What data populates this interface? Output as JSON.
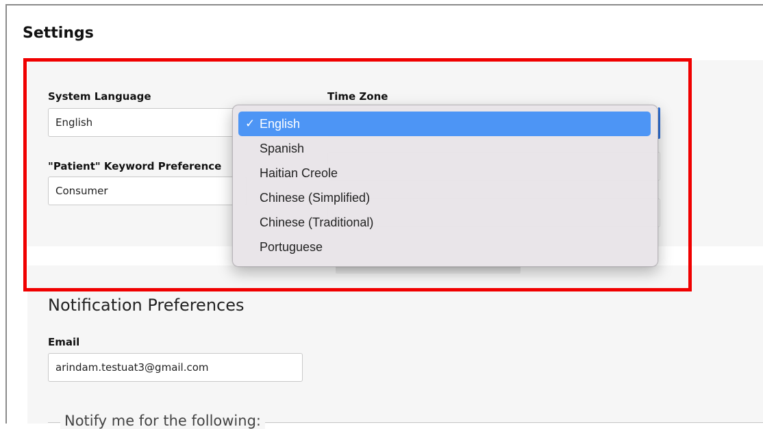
{
  "page": {
    "title": "Settings"
  },
  "account_settings": {
    "system_language": {
      "label": "System Language",
      "value": "English"
    },
    "time_zone": {
      "label": "Time Zone"
    },
    "patient_keyword": {
      "label": "\"Patient\" Keyword Preference",
      "value": "Consumer"
    }
  },
  "language_dropdown": {
    "check_glyph": "✓",
    "options": [
      {
        "label": "English",
        "selected": true
      },
      {
        "label": "Spanish",
        "selected": false
      },
      {
        "label": "Haitian Creole",
        "selected": false
      },
      {
        "label": "Chinese (Simplified)",
        "selected": false
      },
      {
        "label": "Chinese (Traditional)",
        "selected": false
      },
      {
        "label": "Portuguese",
        "selected": false
      }
    ]
  },
  "notifications": {
    "heading": "Notification Preferences",
    "email": {
      "label": "Email",
      "value": "arindam.testuat3@gmail.com"
    },
    "notify_legend": "Notify me for the following:"
  },
  "colors": {
    "highlight": "#f00000",
    "selection": "#4d95f5",
    "panel_bg": "#f6f6f6"
  }
}
